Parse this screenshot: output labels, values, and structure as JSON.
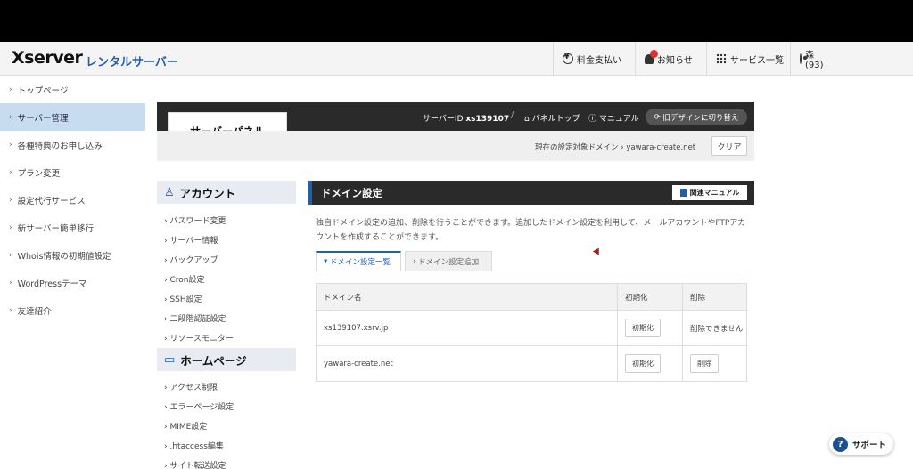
{
  "header": {
    "logo": "Xserver",
    "logo_sub": "レンタルサーバー",
    "nav": {
      "payment": "料金支払い",
      "notice": "お知らせ",
      "services": "サービス一覧",
      "user": "森　　　　　　　　　　(93)"
    }
  },
  "sidebar": {
    "items": [
      {
        "label": "トップページ"
      },
      {
        "label": "サーバー管理"
      },
      {
        "label": "各種特典のお申し込み"
      },
      {
        "label": "プラン変更"
      },
      {
        "label": "設定代行サービス"
      },
      {
        "label": "新サーバー簡単移行"
      },
      {
        "label": "Whois情報の初期値設定"
      },
      {
        "label": "WordPressテーマ"
      },
      {
        "label": "友達紹介"
      }
    ]
  },
  "panel": {
    "title": "サーバーパネル",
    "server_id_label": "サーバーID",
    "server_id": "xs139107",
    "panel_top": "パネルトップ",
    "manual": "マニュアル",
    "old_design": "旧デザインに切り替え",
    "target_label": "現在の設定対象ドメイン",
    "target_domain": "yawara-create.net",
    "clear": "クリア"
  },
  "menu": {
    "account": {
      "title": "アカウント",
      "items": [
        "パスワード変更",
        "サーバー情報",
        "バックアップ",
        "Cron設定",
        "SSH設定",
        "二段階認証設定",
        "リソースモニター"
      ]
    },
    "homepage": {
      "title": "ホームページ",
      "items": [
        "アクセス制限",
        "エラーページ設定",
        "MIME設定",
        ".htaccess編集",
        "サイト転送設定"
      ]
    }
  },
  "main": {
    "title": "ドメイン設定",
    "manual_button": "関連マニュアル",
    "description": "独自ドメイン設定の追加、削除を行うことができます。追加したドメイン設定を利用して、メールアカウントやFTPアカウントを作成することができます。",
    "tabs": [
      "ドメイン設定一覧",
      "ドメイン設定追加"
    ],
    "table": {
      "headers": [
        "ドメイン名",
        "初期化",
        "削除"
      ],
      "rows": [
        {
          "domain": "xs139107.xsrv.jp",
          "init": "初期化",
          "delete": "削除できません"
        },
        {
          "domain": "yawara-create.net",
          "init": "初期化",
          "delete": "削除"
        }
      ]
    }
  },
  "support": "サポート",
  "colors": {
    "accent": "#1f5fae",
    "active_sidebar": "#c8dcf0",
    "dark_bar": "#2a2a2a"
  }
}
